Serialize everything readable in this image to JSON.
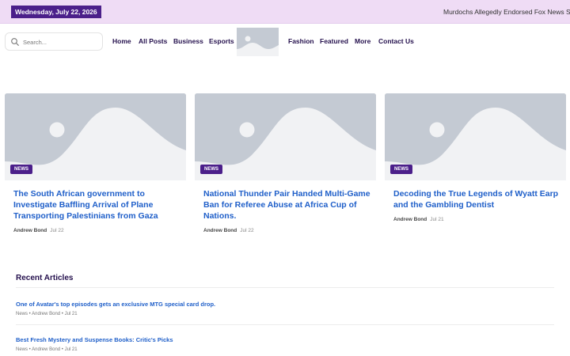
{
  "topbar": {
    "date": "Wednesday, July 22, 2026",
    "ticker": "Murdochs Allegedly Endorsed Fox News Strategy"
  },
  "search": {
    "placeholder": "Search..."
  },
  "menu": {
    "left": [
      "Home",
      "All Posts",
      "Business",
      "Esports"
    ],
    "right": [
      "Fashion",
      "Featured",
      "More",
      "Contact Us"
    ]
  },
  "cards": [
    {
      "tag": "NEWS",
      "title": "The South African government to Investigate Baffling Arrival of Plane Transporting Palestinians from Gaza",
      "author": "Andrew Bond",
      "date": "Jul 22"
    },
    {
      "tag": "NEWS",
      "title": "National Thunder Pair Handed Multi-Game Ban for Referee Abuse at Africa Cup of Nations.",
      "author": "Andrew Bond",
      "date": "Jul 22"
    },
    {
      "tag": "NEWS",
      "title": "Decoding the True Legends of Wyatt Earp and the Gambling Dentist",
      "author": "Andrew Bond",
      "date": "Jul 21"
    }
  ],
  "recent": {
    "heading": "Recent Articles",
    "items": [
      {
        "title": "One of Avatar's top episodes gets an exclusive MTG special card drop.",
        "meta": "News • Andrew Bond • Jul 21"
      },
      {
        "title": "Best Fresh Mystery and Suspense Books: Critic's Picks",
        "meta": "News • Andrew Bond • Jul 21"
      }
    ]
  },
  "colors": {
    "accent": "#4b1f8a",
    "link": "#1f5fc9",
    "topbar_bg": "#efdcf5",
    "placeholder_bg": "#c4cad3"
  },
  "icons": {
    "search": "search-icon",
    "logo": "image-placeholder-icon"
  }
}
